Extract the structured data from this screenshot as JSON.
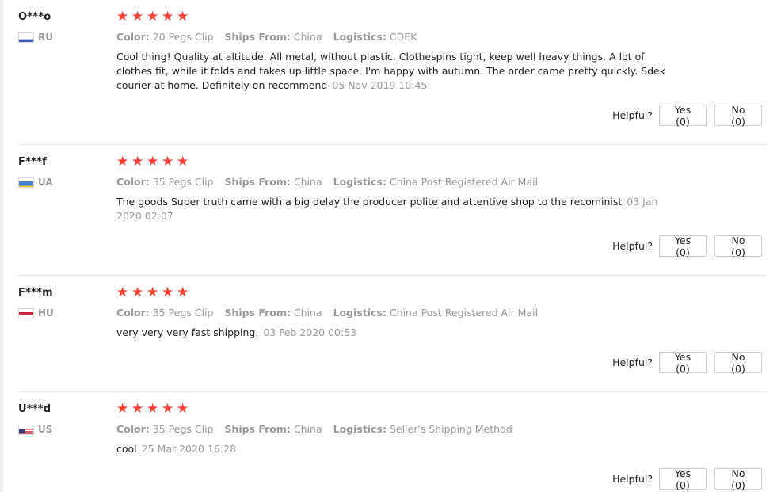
{
  "helpful_label": "Helpful?",
  "accent_color": "#f44336",
  "reviews": [
    {
      "user": "O***o",
      "country": "RU",
      "flag": "russia-flag",
      "rating": 5,
      "color_label": "Color:",
      "color_value": "20 Pegs Clip",
      "ships_label": "Ships From:",
      "ships_value": "China",
      "logistics_label": "Logistics:",
      "logistics_value": "CDEK",
      "text": "Cool thing! Quality at altitude. All metal, without plastic. Clothespins tight, keep well heavy things. A lot of clothes fit, while it folds and takes up little space. I'm happy with autumn. The order came pretty quickly. Sdek courier at home. Definitely on recommend",
      "date": "05 Nov 2019 10:45",
      "yes_label": "Yes (0)",
      "no_label": "No (0)"
    },
    {
      "user": "F***f",
      "country": "UA",
      "flag": "ukraine-flag",
      "rating": 5,
      "color_label": "Color:",
      "color_value": "35 Pegs Clip",
      "ships_label": "Ships From:",
      "ships_value": "China",
      "logistics_label": "Logistics:",
      "logistics_value": "China Post Registered Air Mail",
      "text": "The goods Super truth came with a big delay the producer polite and attentive shop to the recominist",
      "date": "03 Jan 2020 02:07",
      "yes_label": "Yes (0)",
      "no_label": "No (0)"
    },
    {
      "user": "F***m",
      "country": "HU",
      "flag": "hungary-flag",
      "rating": 5,
      "color_label": "Color:",
      "color_value": "35 Pegs Clip",
      "ships_label": "Ships From:",
      "ships_value": "China",
      "logistics_label": "Logistics:",
      "logistics_value": "China Post Registered Air Mail",
      "text": "very very very fast shipping.",
      "date": "03 Feb 2020 00:53",
      "yes_label": "Yes (0)",
      "no_label": "No (0)"
    },
    {
      "user": "U***d",
      "country": "US",
      "flag": "usa-flag",
      "rating": 5,
      "color_label": "Color:",
      "color_value": "35 Pegs Clip",
      "ships_label": "Ships From:",
      "ships_value": "China",
      "logistics_label": "Logistics:",
      "logistics_value": "Seller's Shipping Method",
      "text": "cool",
      "date": "25 Mar 2020 16:28",
      "yes_label": "Yes (0)",
      "no_label": "No (0)"
    }
  ]
}
